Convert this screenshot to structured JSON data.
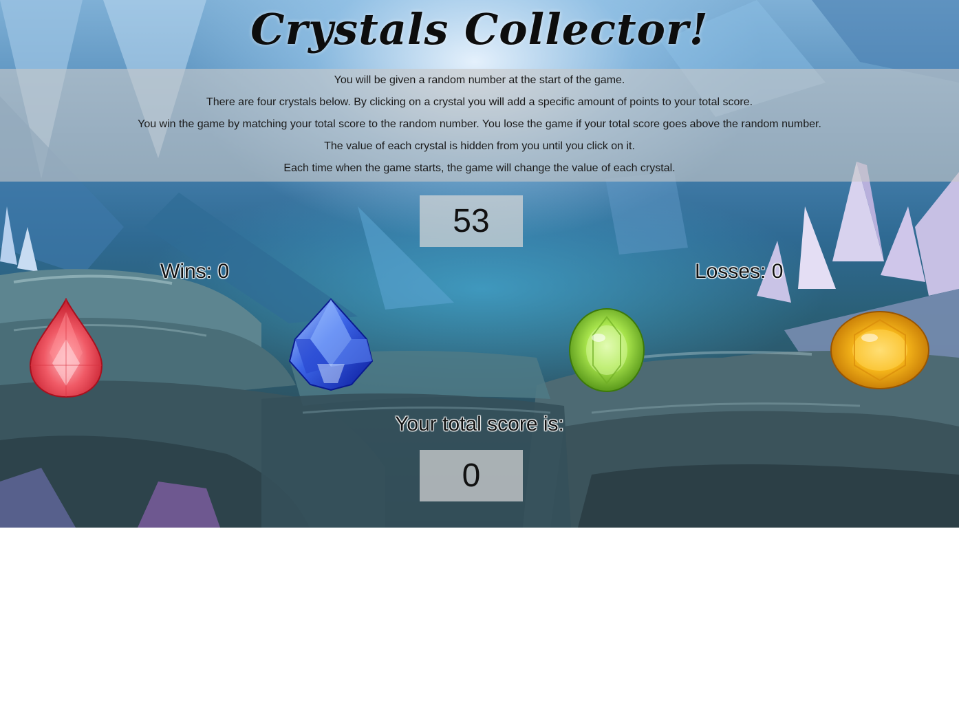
{
  "game": {
    "title": "Crystals Collector!",
    "instructions": [
      "You will be given a random number at the start of the game.",
      "There are four crystals below. By clicking on a crystal you will add a specific amount of points to your total score.",
      "You win the game by matching your total score to the random number. You lose the game if your total score goes above the random number.",
      "The value of each crystal is hidden from you until you click on it.",
      "Each time when the game starts, the game will change the value of each crystal."
    ],
    "target_number": "53",
    "wins_label": "Wins: 0",
    "losses_label": "Losses: 0",
    "score_label": "Your total score is:",
    "total_score": "0",
    "crystals": [
      {
        "icon": "red-pear-crystal-icon",
        "color": "#e8404c"
      },
      {
        "icon": "blue-crystal-icon",
        "color": "#2a4fd8"
      },
      {
        "icon": "green-oval-crystal-icon",
        "color": "#8fd43a"
      },
      {
        "icon": "yellow-oval-crystal-icon",
        "color": "#f0a512"
      }
    ]
  }
}
